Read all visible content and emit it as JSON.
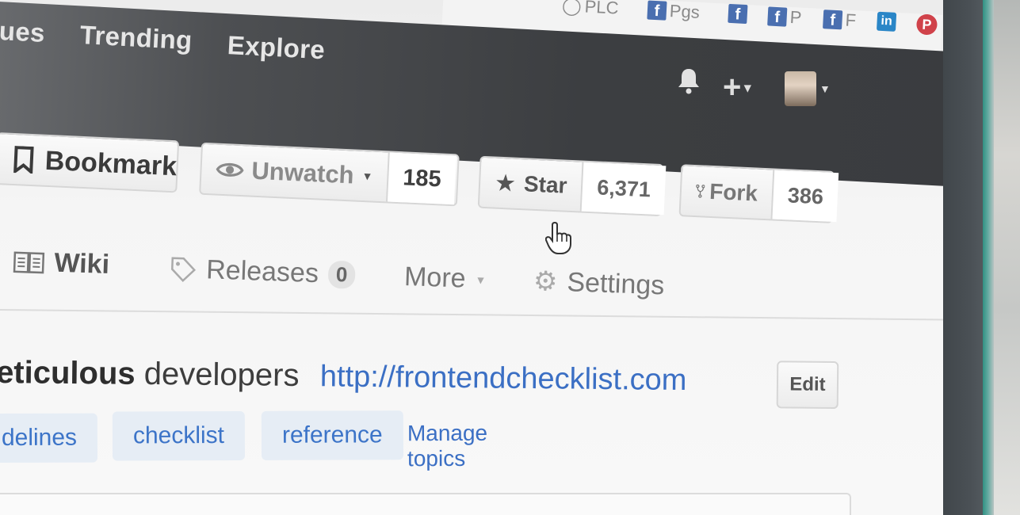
{
  "bookmarks": [
    {
      "label": "PLC",
      "icon": "globe-icon"
    },
    {
      "label": "Pgs",
      "icon": "facebook-icon"
    },
    {
      "label": "",
      "icon": "facebook-icon"
    },
    {
      "label": "P",
      "icon": "facebook-icon"
    },
    {
      "label": "F",
      "icon": "facebook-icon"
    },
    {
      "label": "",
      "icon": "linkedin-icon"
    },
    {
      "label": "",
      "icon": "pinterest-icon"
    }
  ],
  "nav": {
    "issues": "ues",
    "trending": "Trending",
    "explore": "Explore"
  },
  "actions": {
    "bookmark": "Bookmark",
    "unwatch": "Unwatch",
    "watch_count": "185",
    "star": "Star",
    "star_count": "6,371",
    "fork": "Fork",
    "fork_count": "386"
  },
  "tabs": {
    "wiki": "Wiki",
    "releases": "Releases",
    "releases_count": "0",
    "more": "More",
    "settings": "Settings"
  },
  "about": {
    "description_bold": "eticulous",
    "description_rest": " developers",
    "url": "http://frontendchecklist.com",
    "edit": "Edit"
  },
  "topics": [
    "delines",
    "checklist",
    "reference"
  ],
  "manage_topics": "Manage topics",
  "colors": {
    "header_bg": "#3c3e41",
    "link": "#3b6fc4",
    "topic_bg": "#e6edf5"
  }
}
